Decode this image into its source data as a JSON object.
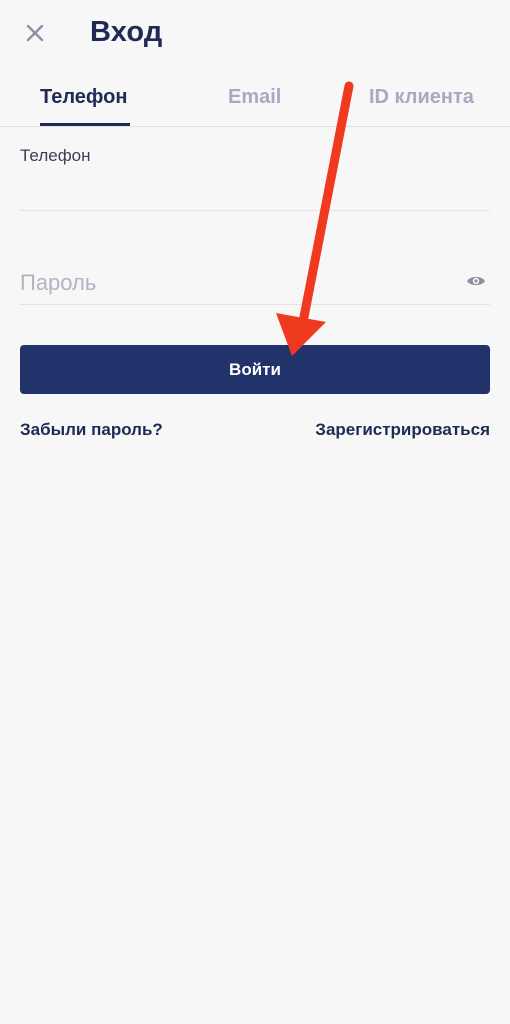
{
  "header": {
    "title": "Вход",
    "close_icon": "close-icon"
  },
  "tabs": [
    {
      "label": "Телефон",
      "active": true
    },
    {
      "label": "Email",
      "active": false
    },
    {
      "label": "ID клиента",
      "active": false
    }
  ],
  "form": {
    "phone_label": "Телефон",
    "phone_value": "",
    "password_placeholder": "Пароль",
    "password_value": "",
    "eye_icon": "eye-icon",
    "login_button": "Войти"
  },
  "links": {
    "forgot_password": "Забыли пароль?",
    "register": "Зарегистрироваться"
  },
  "annotation": {
    "arrow_color": "#f03a1f"
  },
  "colors": {
    "primary": "#22336b",
    "text_dark": "#1f2a55",
    "tab_inactive": "#a8abbf",
    "background": "#f7f7f7"
  }
}
